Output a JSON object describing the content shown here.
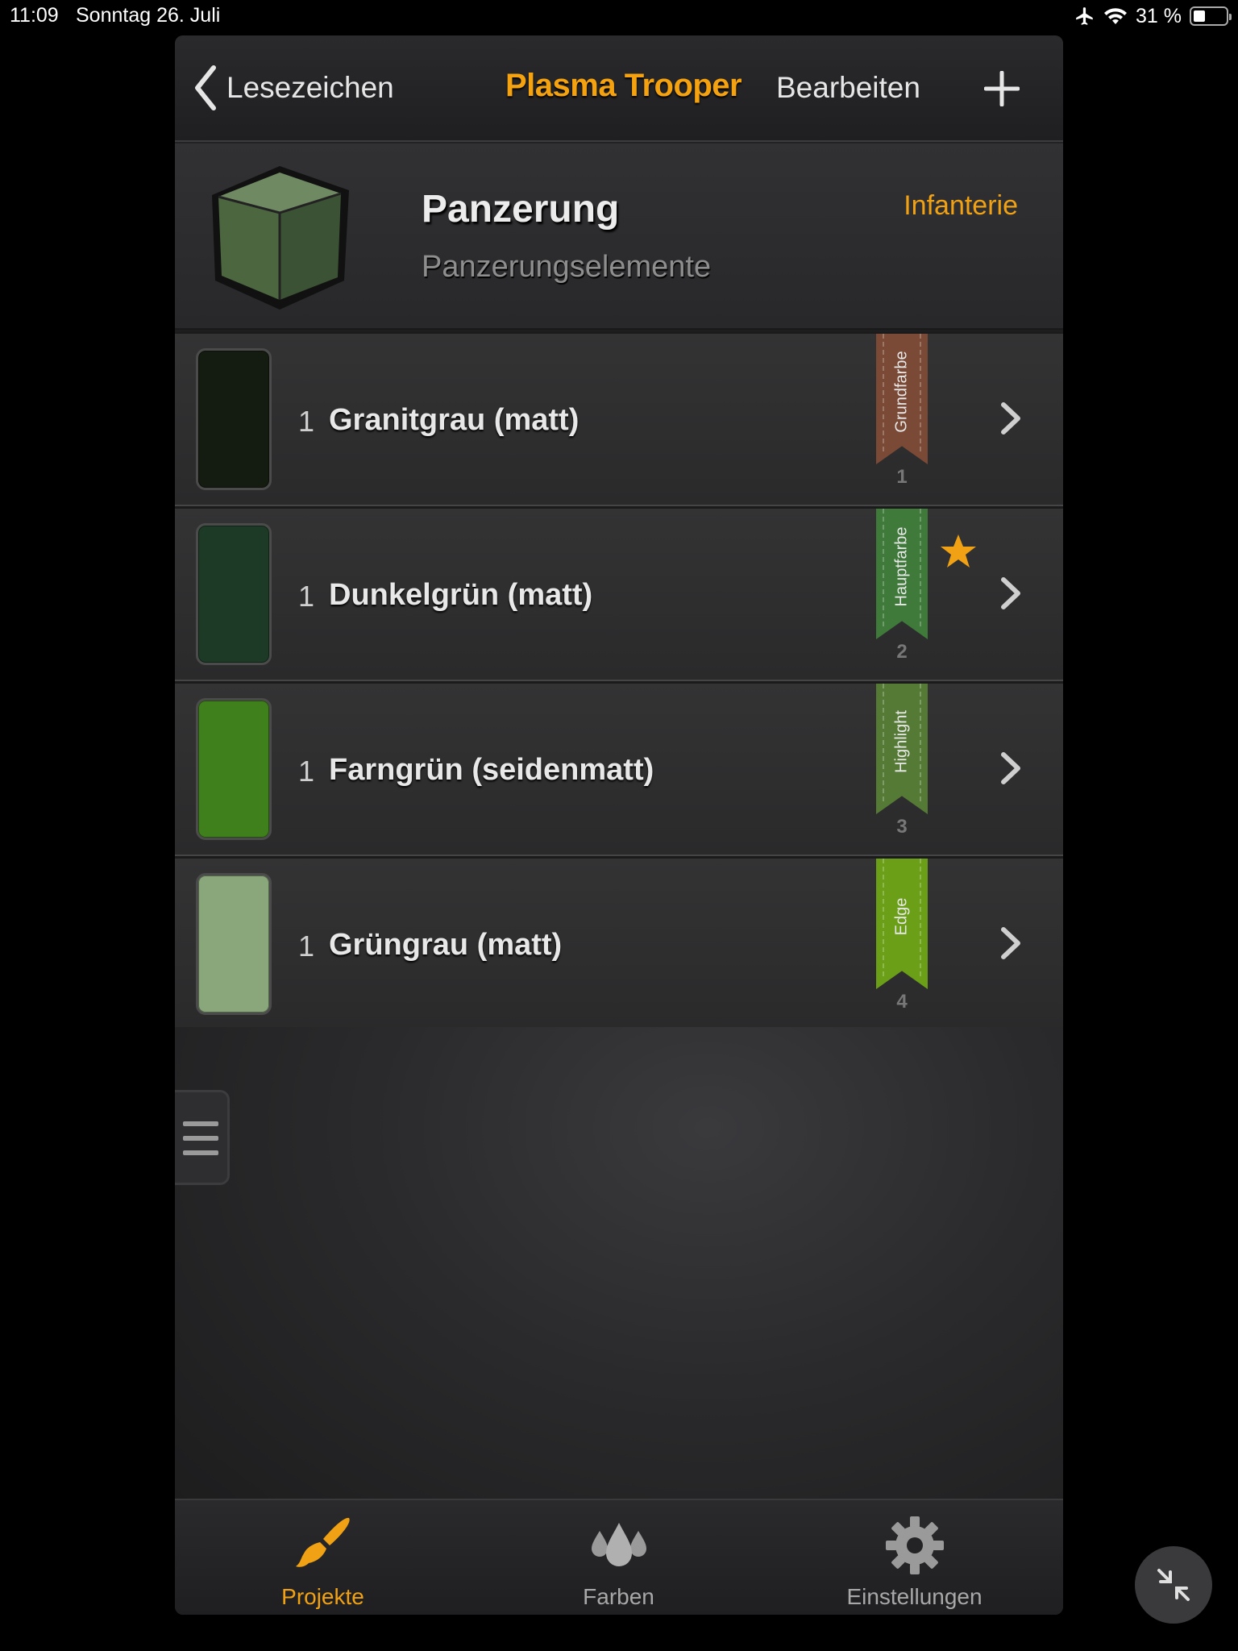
{
  "status_bar": {
    "time": "11:09",
    "date": "Sonntag 26. Juli",
    "battery": "31 %",
    "battery_level": 0.31,
    "icons": [
      "airplane-icon",
      "wifi-icon",
      "battery-icon"
    ]
  },
  "nav": {
    "back_label": "Lesezeichen",
    "title": "Plasma Trooper",
    "edit_label": "Bearbeiten",
    "add_icon": "plus-icon"
  },
  "header": {
    "title": "Panzerung",
    "subtitle": "Panzerungselemente",
    "category": "Infanterie",
    "icon": "cube-icon"
  },
  "paints": [
    {
      "qty": "1",
      "name": "Granitgrau (matt)",
      "color": "#141b10",
      "role": "Grundfarbe",
      "step": "1",
      "ribbon_color": "#7a4a36",
      "favorite": false
    },
    {
      "qty": "1",
      "name": "Dunkelgrün (matt)",
      "color": "#1c3a25",
      "role": "Hauptfarbe",
      "step": "2",
      "ribbon_color": "#3f7a3b",
      "favorite": true
    },
    {
      "qty": "1",
      "name": "Farngrün (seidenmatt)",
      "color": "#3f7f1c",
      "role": "Highlight",
      "step": "3",
      "ribbon_color": "#557a36",
      "favorite": false
    },
    {
      "qty": "1",
      "name": "Grüngrau (matt)",
      "color": "#8aa77c",
      "role": "Edge",
      "step": "4",
      "ribbon_color": "#6a9f17",
      "favorite": false
    }
  ],
  "tabs": [
    {
      "label": "Projekte",
      "icon": "brush-icon",
      "active": true
    },
    {
      "label": "Farben",
      "icon": "drops-icon",
      "active": false
    },
    {
      "label": "Einstellungen",
      "icon": "gear-icon",
      "active": false
    }
  ],
  "colors": {
    "accent": "#f0a114",
    "background": "#222224"
  }
}
